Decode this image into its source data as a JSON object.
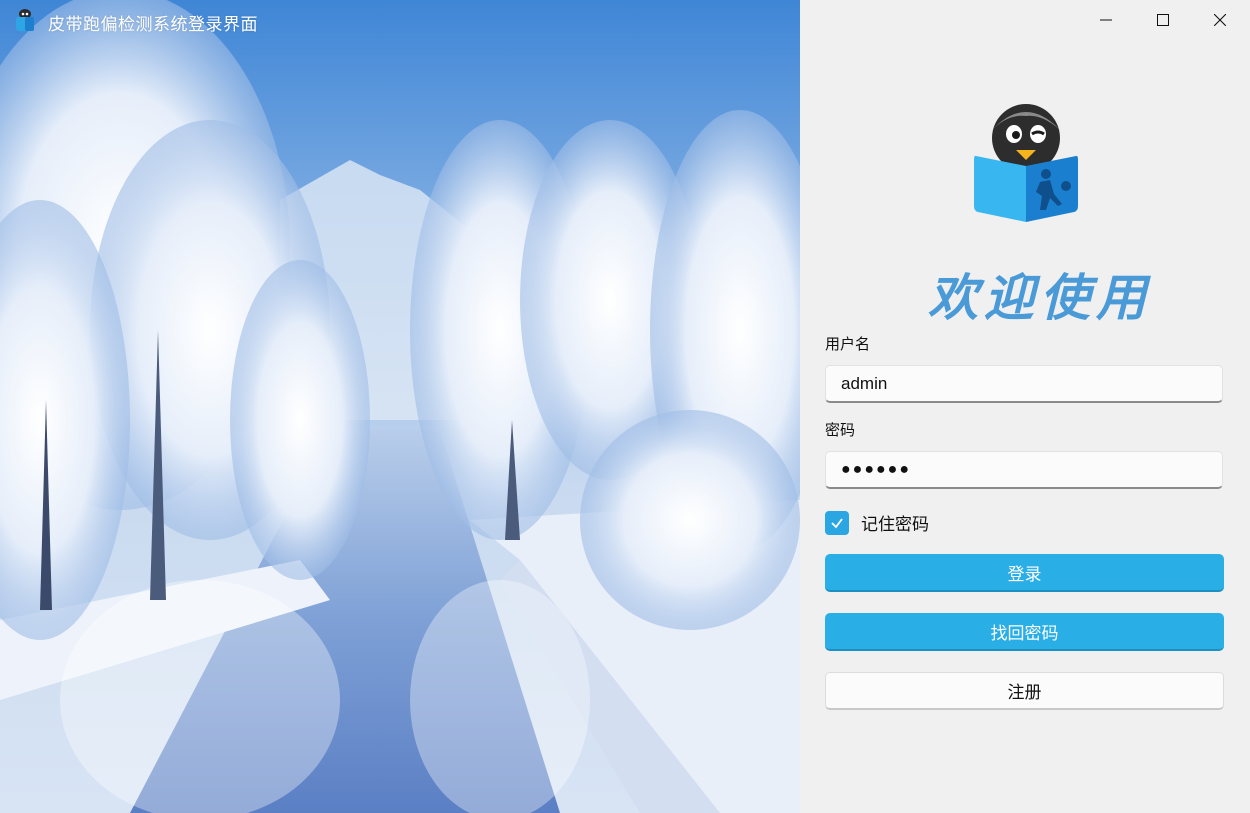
{
  "window": {
    "title": "皮带跑偏检测系统登录界面",
    "minimize_label": "minimize",
    "maximize_label": "maximize",
    "close_label": "close"
  },
  "login": {
    "welcome": "欢迎使用",
    "username_label": "用户名",
    "username_value": "admin",
    "password_label": "密码",
    "password_value": "●●●●●●",
    "remember_label": "记住密码",
    "remember_checked": true,
    "login_button": "登录",
    "recover_button": "找回密码",
    "register_button": "注册"
  },
  "colors": {
    "accent": "#2aaee6",
    "welcome_text": "#4a9ad8",
    "panel_bg": "#f0f0f0"
  },
  "icons": {
    "app": "penguin-book-icon",
    "logo": "penguin-book-logo",
    "minimize": "minimize-icon",
    "maximize": "maximize-icon",
    "close": "close-icon",
    "check": "checkmark-icon"
  }
}
